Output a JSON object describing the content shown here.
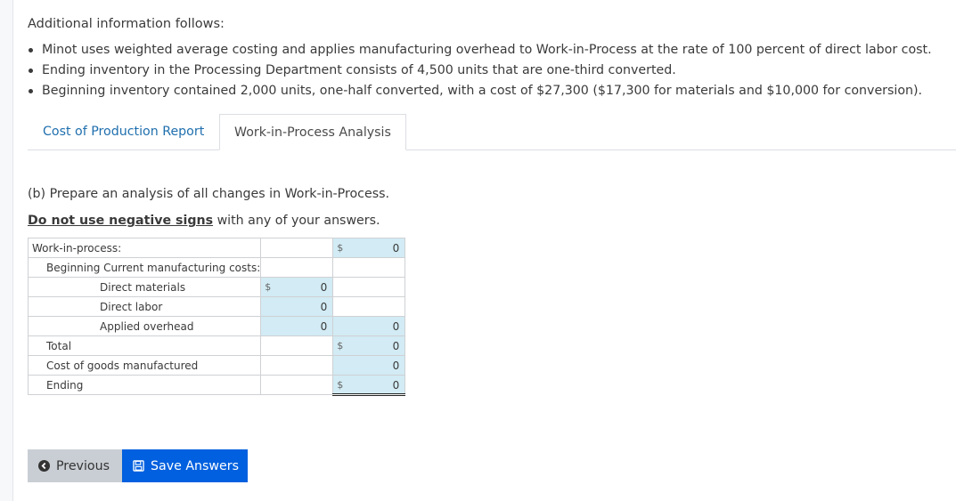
{
  "intro": "Additional information follows:",
  "bullets": [
    "Minot uses weighted average costing and applies manufacturing overhead to Work-in-Process at the rate of 100 percent of direct labor cost.",
    "Ending inventory in the Processing Department consists of 4,500 units that are one-third converted.",
    "Beginning inventory contained 2,000 units, one-half converted, with a cost of $27,300 ($17,300 for materials and $10,000 for conversion)."
  ],
  "tabs": [
    {
      "label": "Cost of Production Report",
      "active": false
    },
    {
      "label": "Work-in-Process Analysis",
      "active": true
    }
  ],
  "prompt": "(b) Prepare an analysis of all changes in Work-in-Process.",
  "warning": {
    "bold": "Do not use negative signs",
    "rest": " with any of your answers."
  },
  "table": {
    "currency": "$",
    "rows": [
      {
        "label": "Work-in-process:",
        "col1": "",
        "col2": "0"
      },
      {
        "label": "Beginning Current manufacturing costs:",
        "col1": "",
        "col2": ""
      },
      {
        "label": "Direct materials",
        "col1": "0",
        "col2": ""
      },
      {
        "label": "Direct labor",
        "col1": "0",
        "col2": ""
      },
      {
        "label": "Applied overhead",
        "col1": "0",
        "col2": "0"
      },
      {
        "label": "Total",
        "col1": "",
        "col2": "0"
      },
      {
        "label": "Cost of goods manufactured",
        "col1": "",
        "col2": "0"
      },
      {
        "label": "Ending",
        "col1": "",
        "col2": "0"
      }
    ]
  },
  "buttons": {
    "previous": "Previous",
    "save": "Save Answers"
  }
}
